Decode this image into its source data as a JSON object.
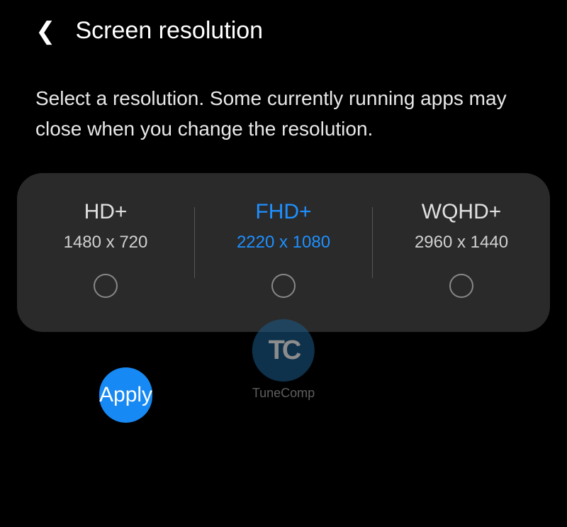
{
  "header": {
    "title": "Screen resolution"
  },
  "description": "Select a resolution. Some currently running apps may close when you change the resolution.",
  "options": [
    {
      "label": "HD+",
      "detail": "1480 x 720",
      "selected": false
    },
    {
      "label": "FHD+",
      "detail": "2220 x 1080",
      "selected": true
    },
    {
      "label": "WQHD+",
      "detail": "2960 x 1440",
      "selected": false
    }
  ],
  "apply_label": "Apply",
  "watermark": {
    "logo": "TC",
    "text": "TuneComp"
  }
}
